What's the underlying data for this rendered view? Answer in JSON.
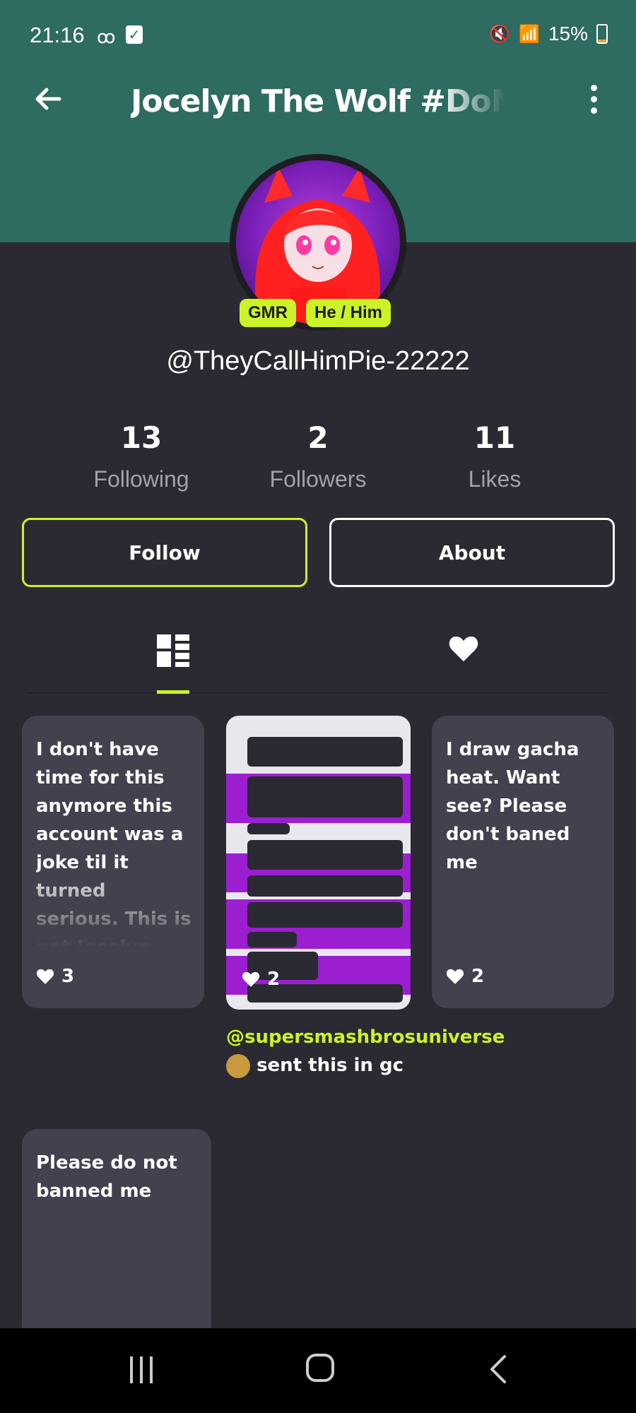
{
  "status_bar": {
    "time": "21:16",
    "battery": "15%",
    "battery_level": 0.15
  },
  "header": {
    "title": "Jocelyn The Wolf #DoN"
  },
  "profile": {
    "badges": [
      "GMR",
      "He / Him"
    ],
    "handle": "@TheyCallHimPie-22222",
    "stats": [
      {
        "value": "13",
        "label": "Following"
      },
      {
        "value": "2",
        "label": "Followers"
      },
      {
        "value": "11",
        "label": "Likes"
      }
    ]
  },
  "actions": {
    "follow_label": "Follow",
    "about_label": "About"
  },
  "tabs": [
    {
      "icon": "grid-icon",
      "active": true
    },
    {
      "icon": "heart-icon",
      "active": false
    }
  ],
  "posts": [
    {
      "text": "I don't have time for this anymore this account was a joke til it turned serious. This is not Jocelyn this is @scugkat",
      "likes": "3"
    },
    {
      "likes": "2",
      "mention": "@supersmashbrosuniverse",
      "caption_rest": "sent this in gc"
    },
    {
      "text": "I draw gacha heat. Want see? Please don't baned me",
      "likes": "2"
    },
    {
      "text": "Please do not banned me"
    }
  ],
  "colors": {
    "header_bg": "#2e6b61",
    "body_bg": "#2b2a33",
    "accent": "#cbf328",
    "card_bg": "#43414d"
  }
}
